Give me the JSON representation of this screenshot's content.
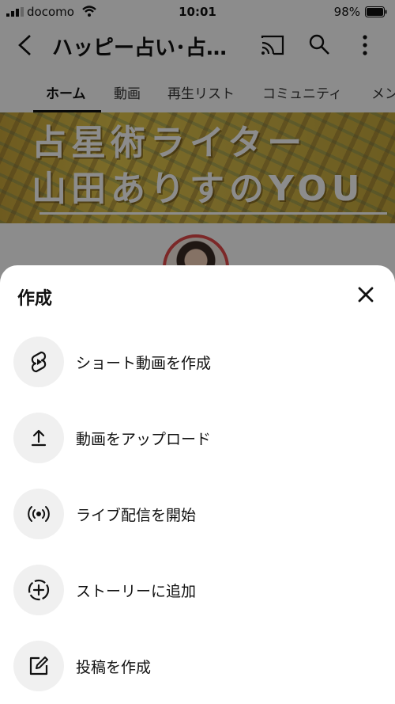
{
  "status_bar": {
    "carrier": "docomo",
    "time": "10:01",
    "battery": "98%"
  },
  "header": {
    "channel_title": "ハッピー占い･占…"
  },
  "tabs": [
    {
      "label": "ホーム"
    },
    {
      "label": "動画"
    },
    {
      "label": "再生リスト"
    },
    {
      "label": "コミュニティ"
    },
    {
      "label": "メン"
    }
  ],
  "banner": {
    "line1": "占星術ライター",
    "line2": "山田ありすのYOU"
  },
  "sheet": {
    "title": "作成",
    "items": [
      {
        "label": "ショート動画を作成",
        "icon": "shorts-icon"
      },
      {
        "label": "動画をアップロード",
        "icon": "upload-icon"
      },
      {
        "label": "ライブ配信を開始",
        "icon": "live-icon"
      },
      {
        "label": "ストーリーに追加",
        "icon": "story-add-icon"
      },
      {
        "label": "投稿を作成",
        "icon": "edit-post-icon"
      }
    ]
  }
}
